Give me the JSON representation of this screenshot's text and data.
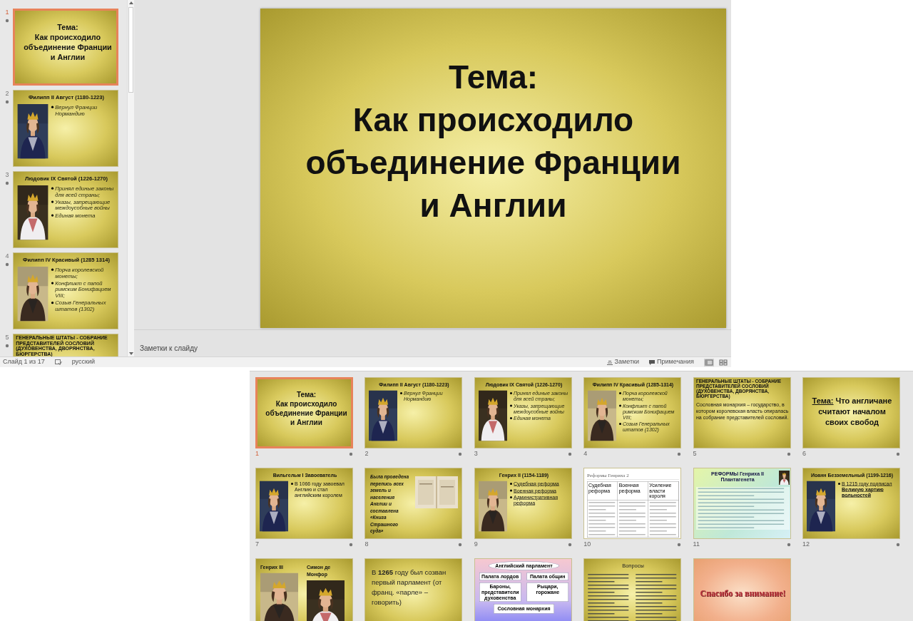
{
  "slide_panel": {
    "thumbnails": [
      {
        "number": "1",
        "selected": true,
        "kind": "title",
        "lines": [
          "Тема:",
          "Как происходило",
          "объединение Франции",
          "и Англии"
        ]
      },
      {
        "number": "2",
        "selected": false,
        "kind": "portrait",
        "title": "Филипп II Август (1180-1223)",
        "italic": true,
        "underlined": false,
        "bullets": [
          "Вернул Франции Нормандию"
        ]
      },
      {
        "number": "3",
        "selected": false,
        "kind": "portrait",
        "title": "Людовик IX Святой (1226-1270)",
        "italic": true,
        "underlined": false,
        "bullets": [
          "Принял единые законы для всей страны;",
          "Указы, запрещающие междоусобные войны",
          "Единая монета"
        ]
      },
      {
        "number": "4",
        "selected": false,
        "kind": "portrait",
        "title": "Филипп IV Красивый (1285 1314)",
        "italic": true,
        "underlined": false,
        "bullets": [
          "Порча королевской монеты;",
          "Конфликт с папой римским Бонифацием VIII;",
          "Созыв Генеральных штатов (1302)"
        ]
      },
      {
        "number": "5",
        "selected": false,
        "kind": "text",
        "heading": "ГЕНЕРАЛЬНЫЕ ШТАТЫ - СОБРАНИЕ ПРЕДСТАВИТЕЛЕЙ СОСЛОВИЙ (ДУХОВЕНСТВА, ДВОРЯНСТВА, БЮРГЕРСТВА)"
      }
    ]
  },
  "main_slide": {
    "lines": [
      "Тема:",
      "Как происходило",
      "объединение Франции",
      "и Англии"
    ]
  },
  "notes": {
    "placeholder": "Заметки к слайду"
  },
  "status_bar": {
    "slide_info": "Слайд 1 из 17",
    "language": "русский",
    "notes_button": "Заметки",
    "comments_button": "Примечания"
  },
  "slide_sorter": {
    "thumbnails": [
      {
        "number": "1",
        "selected": true,
        "kind": "title",
        "lines": [
          "Тема:",
          "Как происходило",
          "объединение Франции",
          "и Англии"
        ]
      },
      {
        "number": "2",
        "selected": false,
        "kind": "portrait",
        "title": "Филипп II Август (1180-1223)",
        "italic": true,
        "underlined": false,
        "bullets": [
          "Вернул Франции Нормандию"
        ]
      },
      {
        "number": "3",
        "selected": false,
        "kind": "portrait",
        "title": "Людовик IX Святой (1226-1270)",
        "italic": true,
        "underlined": false,
        "bullets": [
          "Принял единые законы для всей страны;",
          "Указы, запрещающие междоусобные войны",
          "Единая монета"
        ]
      },
      {
        "number": "4",
        "selected": false,
        "kind": "portrait",
        "title": "Филипп IV Красивый (1285-1314)",
        "italic": true,
        "underlined": false,
        "bullets": [
          "Порча королевской монеты;",
          "Конфликт с папой римским Бонифацием VIII;",
          "Созыв Генеральных штатов (1302)"
        ]
      },
      {
        "number": "5",
        "selected": false,
        "kind": "text",
        "heading": "ГЕНЕРАЛЬНЫЕ ШТАТЫ - СОБРАНИЕ ПРЕДСТАВИТЕЛЕЙ СОСЛОВИЙ (ДУХОВЕНСТВА, ДВОРЯНСТВА, БЮРГЕРСТВА)",
        "paragraph": "Сословная монархия – государство, в котором королевская власть опиралась на собрание представителей сословий."
      },
      {
        "number": "6",
        "selected": false,
        "kind": "title",
        "lead": "Тема:",
        "lines": [
          "Что англичане",
          "считают началом",
          "своих свобод"
        ]
      },
      {
        "number": "7",
        "selected": false,
        "kind": "portrait",
        "title": "Вильгельм I Завоеватель",
        "italic": false,
        "underlined": false,
        "bullets": [
          "В 1066 году завоевал Англию и стал английским королем"
        ]
      },
      {
        "number": "8",
        "selected": false,
        "kind": "text_picture",
        "text": "Была проведена перепись всех земель и населения Англии и составлена «Книга Страшного суда»"
      },
      {
        "number": "9",
        "selected": false,
        "kind": "portrait",
        "title": "Генрих II (1154-1189)",
        "italic": false,
        "underlined": true,
        "bullets": [
          "Судебная реформа",
          "Военная реформа",
          "Административная реформа"
        ]
      },
      {
        "number": "10",
        "selected": false,
        "kind": "table",
        "title": "Реформы Генриха 2",
        "columns": [
          "Судебная реформа",
          "Военная реформа",
          "Усиление власти короля"
        ]
      },
      {
        "number": "11",
        "selected": false,
        "kind": "colored_table",
        "title": "РЕФОРМЫ Генриха II Плантагенета"
      },
      {
        "number": "12",
        "selected": false,
        "kind": "portrait",
        "title": "Иоанн Безземельный (1199-1216)",
        "italic": false,
        "underlined": true,
        "bullets": [
          "В 1215 году подписал **Великую хартию вольностей**"
        ]
      },
      {
        "selected": false,
        "kind": "two_portraits",
        "captions": [
          "Генрих III",
          "Симон де Монфор"
        ]
      },
      {
        "selected": false,
        "kind": "statement",
        "text": "В **1265** году был созван первый парламент (от франц. «парле» – говорить)"
      },
      {
        "selected": false,
        "kind": "diagram",
        "title": "Английский парламент",
        "boxes": [
          "Палата лордов",
          "Палата общин",
          "Бароны, представители духовенства",
          "Рыцари, горожане"
        ],
        "footer": "Сословная монархия"
      },
      {
        "selected": false,
        "kind": "questions",
        "title": "Вопросы"
      },
      {
        "selected": false,
        "kind": "thanks",
        "text": "Спасибо за внимание!"
      }
    ]
  }
}
